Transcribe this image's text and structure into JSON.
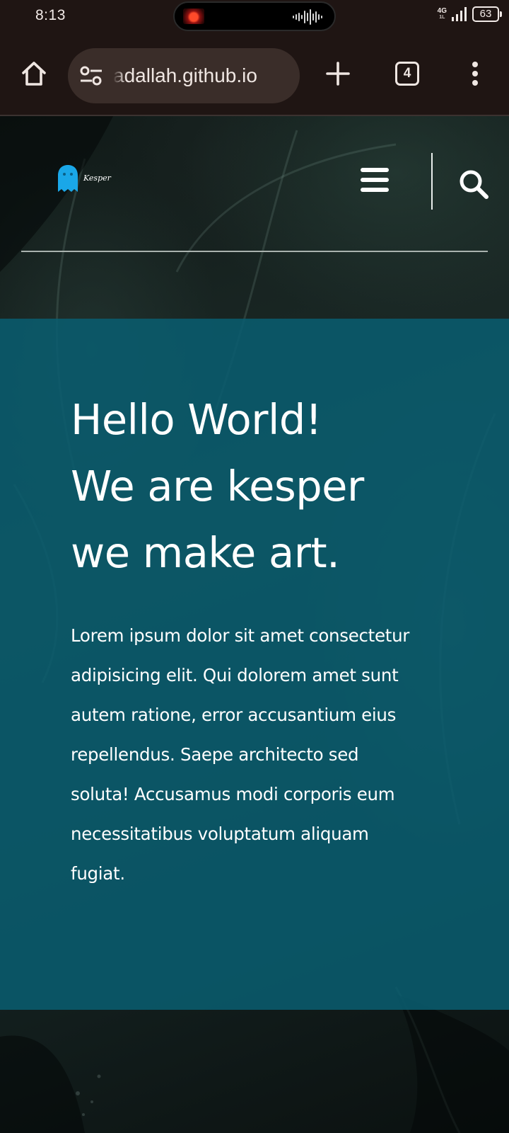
{
  "status_bar": {
    "time": "8:13",
    "network": "4G",
    "network_sub": "1L",
    "battery": "63"
  },
  "browser": {
    "url": "adallah.github.io",
    "tab_count": "4",
    "icons": [
      "home-icon",
      "site-settings-icon",
      "new-tab-plus-icon",
      "tab-switcher-icon",
      "more-menu-icon"
    ]
  },
  "site": {
    "logo_text": "Kesper",
    "hero": {
      "title_lines": [
        "Hello World!",
        "We are kesper",
        "we make art."
      ],
      "body": "Lorem ipsum dolor sit amet consectetur adipisicing elit. Qui dolorem amet sunt autem ratione, error accusantium eius repellendus. Saepe architecto sed soluta! Accusamus modi corporis eum necessitatibus voluptatum aliquam fugiat."
    }
  },
  "colors": {
    "browser_chrome": "#1f1513",
    "url_pill": "#3a2d29",
    "hero_overlay": "#095d70",
    "logo_ghost": "#1aa7e8"
  }
}
